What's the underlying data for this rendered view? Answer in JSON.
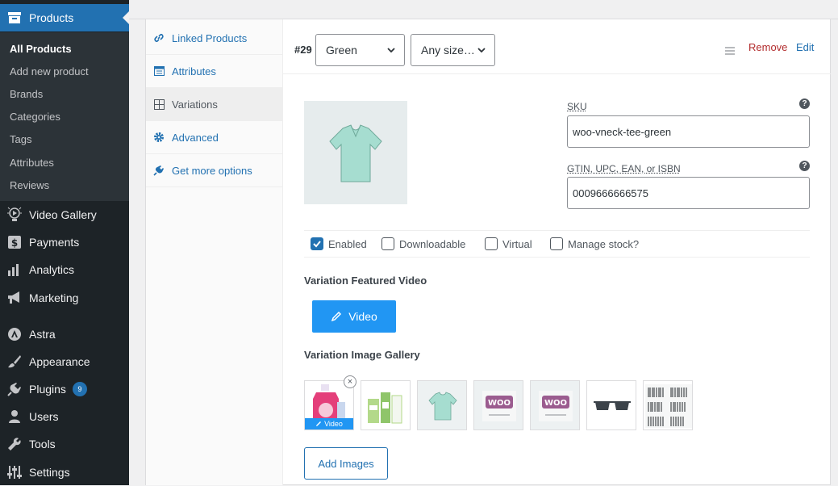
{
  "sidebar": {
    "products_label": "Products",
    "submenu": [
      "All Products",
      "Add new product",
      "Brands",
      "Categories",
      "Tags",
      "Attributes",
      "Reviews"
    ],
    "items": [
      "Video Gallery",
      "Payments",
      "Analytics",
      "Marketing",
      "Astra",
      "Appearance",
      "Plugins",
      "Users",
      "Tools",
      "Settings"
    ],
    "plugins_badge": "9"
  },
  "tabs": [
    "Linked Products",
    "Attributes",
    "Variations",
    "Advanced",
    "Get more options"
  ],
  "variation": {
    "number": "#29",
    "color_value": "Green",
    "size_value": "Any size…",
    "remove_label": "Remove",
    "edit_label": "Edit",
    "sku_label": "SKU",
    "sku_value": "woo-vneck-tee-green",
    "gtin_label": "GTIN, UPC, EAN, or ISBN",
    "gtin_value": "0009666666575",
    "help_glyph": "?",
    "checkboxes": [
      {
        "label": "Enabled",
        "checked": true
      },
      {
        "label": "Downloadable",
        "checked": false
      },
      {
        "label": "Virtual",
        "checked": false
      },
      {
        "label": "Manage stock?",
        "checked": false
      }
    ],
    "featured_video_title": "Variation Featured Video",
    "video_button_label": "Video",
    "gallery_title": "Variation Image Gallery",
    "gallery_video_badge": "Video",
    "add_images_label": "Add Images"
  },
  "colors": {
    "accent": "#2271b1",
    "button_blue": "#2196f3",
    "remove_red": "#b32d2e",
    "sidebar_bg": "#1d2327"
  }
}
